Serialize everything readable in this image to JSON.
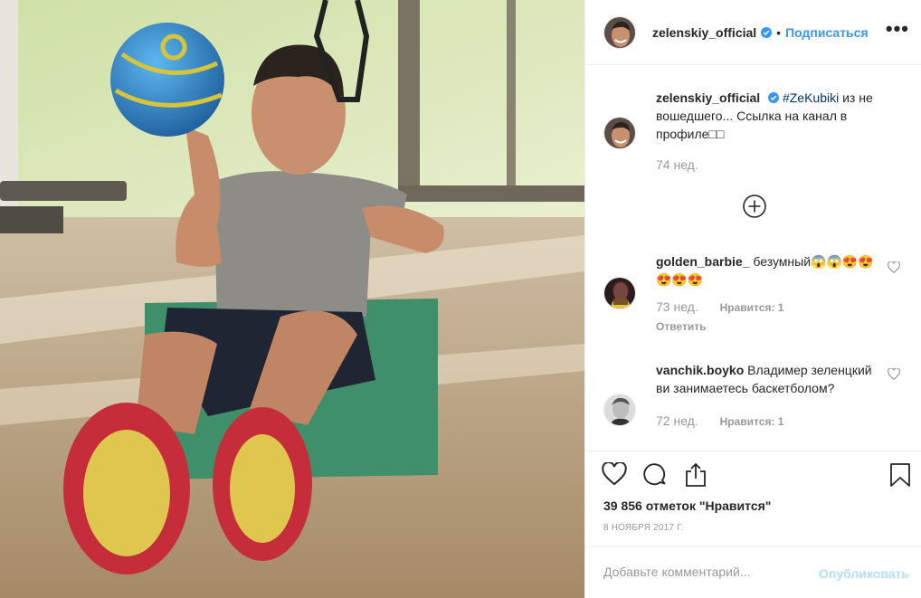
{
  "post": {
    "image_alt": "",
    "author": "zelenskiy_official",
    "follow_label": "Подписаться",
    "dot": "•",
    "more_label": "•••"
  },
  "caption": {
    "username": "zelenskiy_official",
    "hashtag": "#ZeKubiki",
    "text": " из не вошедшего... Ссылка на канал в профиле□□",
    "time": "74 нед."
  },
  "comments": [
    {
      "username": "golden_barbie_",
      "text": " безумный😱😱😍😍😍😍😍",
      "time": "73 нед.",
      "likes": "Нравится: 1",
      "reply": "Ответить"
    },
    {
      "username": "vanchik.boyko",
      "text": " Владимер зеленцкий ви занимаетесь баскетболом?",
      "time": "72 нед.",
      "likes": "Нравится: 1"
    }
  ],
  "stats": {
    "likes_text": "39 856 отметок \"Нравится\"",
    "date": "8 НОЯБРЯ 2017 Г."
  },
  "comment_box": {
    "placeholder": "Добавьте комментарий...",
    "publish_label": "Опубликовать"
  },
  "colors": {
    "link": "#3897f0",
    "publish_disabled": "#b2dffc",
    "muted": "#999999",
    "text": "#262626"
  },
  "icons": [
    "verified-icon",
    "more-icon",
    "add-circle-icon",
    "heart-icon",
    "comment-icon",
    "share-icon",
    "bookmark-icon"
  ]
}
